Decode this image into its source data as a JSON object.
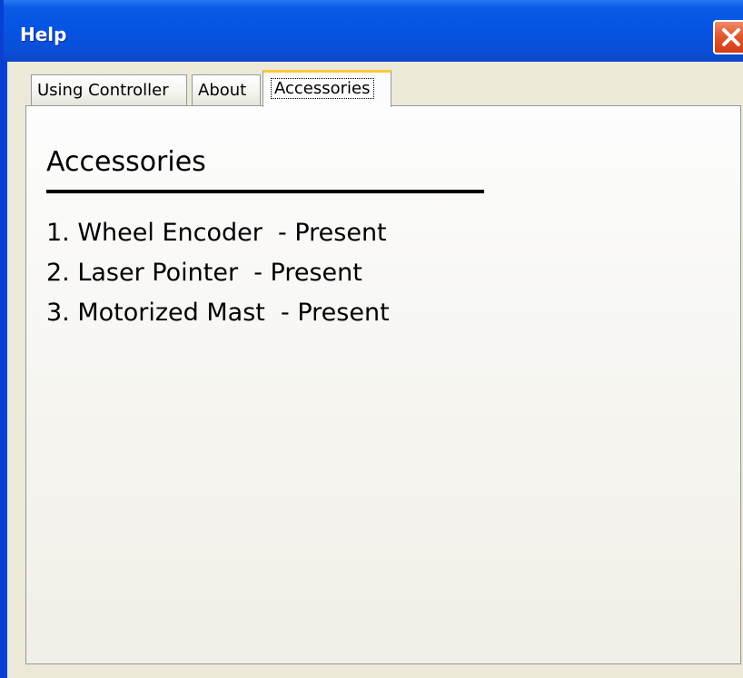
{
  "window": {
    "title": "Help"
  },
  "tabs": [
    {
      "label": "Using Controller",
      "selected": false
    },
    {
      "label": "About",
      "selected": false
    },
    {
      "label": "Accessories",
      "selected": true
    }
  ],
  "content": {
    "heading": "Accessories",
    "items": [
      "1. Wheel Encoder  - Present",
      "2. Laser Pointer  - Present",
      "3. Motorized Mast  - Present"
    ]
  },
  "colors": {
    "titlebar": "#0554e3",
    "close_button": "#e2582e",
    "tab_highlight": "#ffc83c",
    "panel_background": "#f7f6f2"
  },
  "icons": {
    "close": "close-icon"
  }
}
